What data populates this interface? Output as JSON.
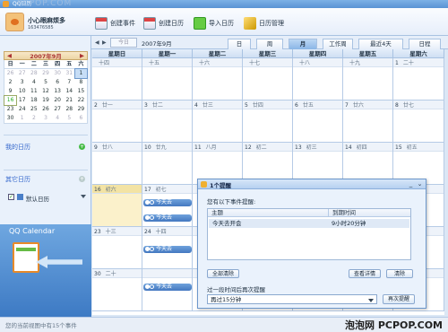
{
  "window": {
    "title": "QQ日历"
  },
  "watermark": {
    "top": "PCPOP.COM",
    "bottom": "泡泡网 PCPOP.COM"
  },
  "user": {
    "name": "小心眼麻烦多",
    "id": "163476585"
  },
  "toolbar": {
    "new_event": "创建事件",
    "new_calendar": "创建日历",
    "import": "导入日历",
    "manage": "日历管理"
  },
  "mini_calendar": {
    "title": "2007年9月",
    "weekdays": [
      "日",
      "一",
      "二",
      "三",
      "四",
      "五",
      "六"
    ],
    "rows": [
      [
        "26",
        "27",
        "28",
        "29",
        "30",
        "31",
        "1"
      ],
      [
        "2",
        "3",
        "4",
        "5",
        "6",
        "7",
        "8"
      ],
      [
        "9",
        "10",
        "11",
        "12",
        "13",
        "14",
        "15"
      ],
      [
        "16",
        "17",
        "18",
        "19",
        "20",
        "21",
        "22"
      ],
      [
        "23",
        "24",
        "25",
        "26",
        "27",
        "28",
        "29"
      ],
      [
        "30",
        "1",
        "2",
        "3",
        "4",
        "5",
        "6"
      ]
    ]
  },
  "sidebar": {
    "my_calendars": "我的日历",
    "default_calendar": "默认日历",
    "other_calendars": "其它日历",
    "promo": "QQ Calendar"
  },
  "nav": {
    "today": "今日",
    "current": "2007年9月",
    "views": [
      "日",
      "周",
      "月",
      "工作周",
      "最近4天",
      "日程"
    ]
  },
  "weekday_headers": [
    "星期日",
    "星期一",
    "星期二",
    "星期三",
    "星期四",
    "星期五",
    "星期六"
  ],
  "weeks": [
    [
      {
        "d": "",
        "l": "十四"
      },
      {
        "d": "",
        "l": "十五"
      },
      {
        "d": "",
        "l": "十六"
      },
      {
        "d": "",
        "l": "十七"
      },
      {
        "d": "",
        "l": "十八"
      },
      {
        "d": "",
        "l": "十九"
      },
      {
        "d": "1",
        "l": "二十"
      }
    ],
    [
      {
        "d": "2",
        "l": "廿一"
      },
      {
        "d": "3",
        "l": "廿二"
      },
      {
        "d": "4",
        "l": "廿三"
      },
      {
        "d": "5",
        "l": "廿四"
      },
      {
        "d": "6",
        "l": "廿五"
      },
      {
        "d": "7",
        "l": "廿六"
      },
      {
        "d": "8",
        "l": "廿七"
      }
    ],
    [
      {
        "d": "9",
        "l": "廿八"
      },
      {
        "d": "10",
        "l": "廿九"
      },
      {
        "d": "11",
        "l": "八月"
      },
      {
        "d": "12",
        "l": "初二"
      },
      {
        "d": "13",
        "l": "初三"
      },
      {
        "d": "14",
        "l": "初四"
      },
      {
        "d": "15",
        "l": "初五"
      }
    ],
    [
      {
        "d": "16",
        "l": "初六"
      },
      {
        "d": "17",
        "l": "初七"
      },
      {
        "d": "",
        "l": ""
      },
      {
        "d": "",
        "l": ""
      },
      {
        "d": "",
        "l": ""
      },
      {
        "d": "",
        "l": ""
      },
      {
        "d": "",
        "l": ""
      }
    ],
    [
      {
        "d": "23",
        "l": "十三"
      },
      {
        "d": "24",
        "l": "十四"
      },
      {
        "d": "",
        "l": ""
      },
      {
        "d": "",
        "l": ""
      },
      {
        "d": "",
        "l": ""
      },
      {
        "d": "",
        "l": ""
      },
      {
        "d": "",
        "l": ""
      }
    ],
    [
      {
        "d": "30",
        "l": "二十"
      },
      {
        "d": "",
        "l": ""
      },
      {
        "d": "",
        "l": ""
      },
      {
        "d": "",
        "l": ""
      },
      {
        "d": "",
        "l": ""
      },
      {
        "d": "",
        "l": ""
      },
      {
        "d": "",
        "l": ""
      }
    ]
  ],
  "event_label": "今天去",
  "status": "您的当前视图中有15个事件",
  "dialog": {
    "title": "1个提醒",
    "prompt": "您有以下事件提醒:",
    "col_subject": "主题",
    "col_due": "到期时间",
    "row_subject": "今天去开会",
    "row_due": "9小时20分钟",
    "dismiss_all": "全部清除",
    "view_detail": "查看详情",
    "dismiss": "清除",
    "snooze_prompt": "过一段时间后再次提醒",
    "snooze_value": "再过15分钟",
    "snooze_button": "再次提醒"
  }
}
